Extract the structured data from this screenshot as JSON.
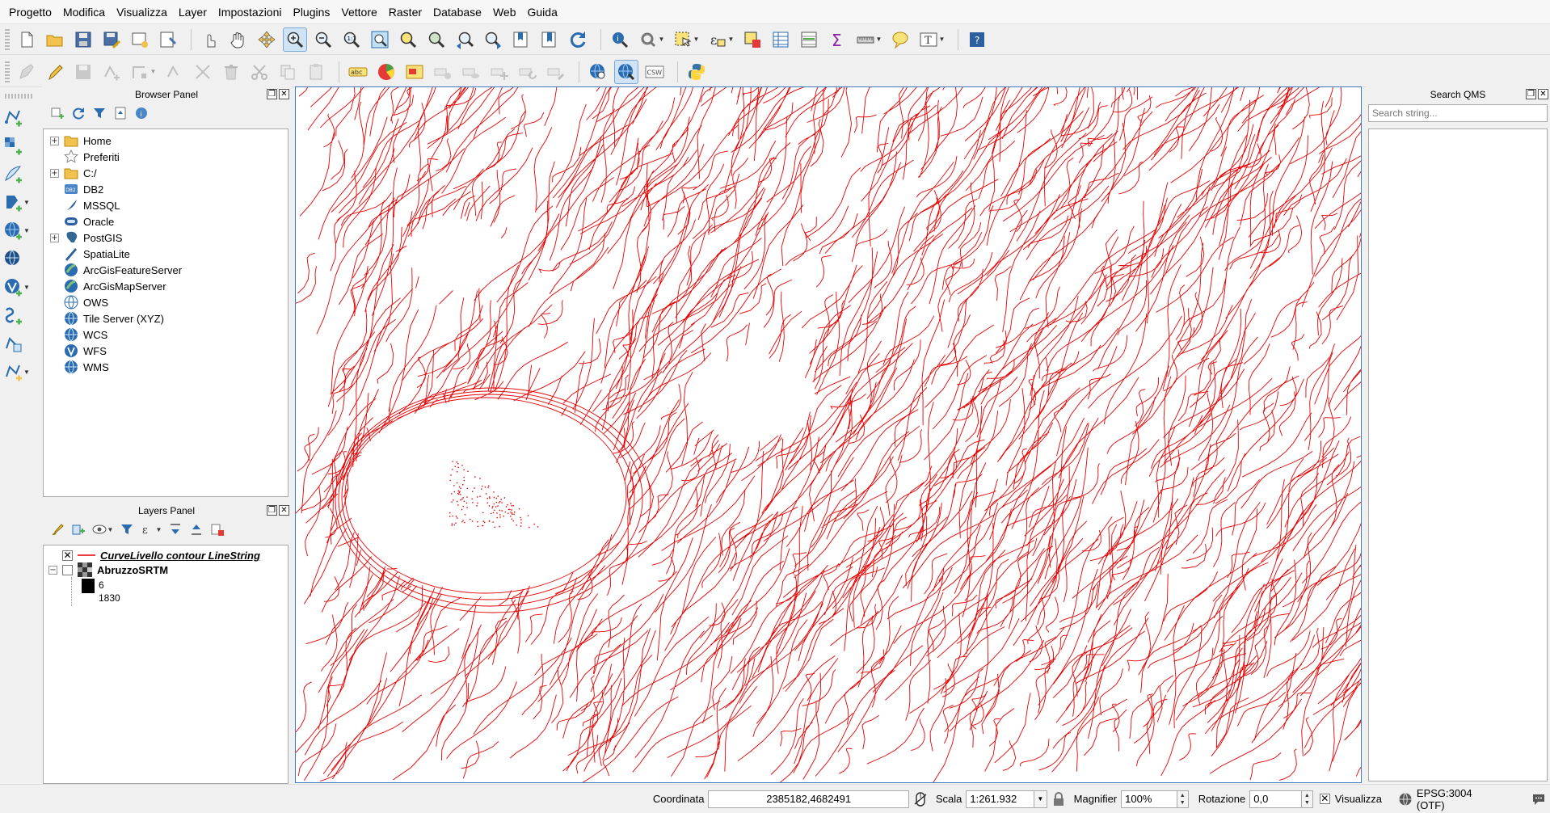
{
  "menubar": {
    "items": [
      "Progetto",
      "Modifica",
      "Visualizza",
      "Layer",
      "Impostazioni",
      "Plugins",
      "Vettore",
      "Raster",
      "Database",
      "Web",
      "Guida"
    ]
  },
  "toolbars": {
    "row1_icons": [
      "new-project-icon",
      "open-project-icon",
      "save-project-icon",
      "save-as-icon",
      "new-print-layout-icon",
      "layout-manager-icon",
      "touch-zoom-icon",
      "pan-icon",
      "pan-to-selection-icon",
      "zoom-in-icon",
      "zoom-out-icon",
      "zoom-native-icon",
      "zoom-full-icon",
      "zoom-to-selection-icon",
      "zoom-to-layer-icon",
      "zoom-last-icon",
      "zoom-next-icon",
      "new-bookmark-icon",
      "show-bookmarks-icon",
      "refresh-icon",
      "identify-icon",
      "action-icon",
      "select-feature-icon",
      "select-by-expression-icon",
      "deselect-icon",
      "attribute-table-icon",
      "field-calculator-icon",
      "statistics-icon",
      "measure-icon",
      "map-tips-icon",
      "text-annotation-icon",
      "help-icon"
    ],
    "row2_icons": [
      "current-edits-icon",
      "toggle-editing-icon",
      "save-edits-icon",
      "add-feature-icon",
      "vertex-tool-icon",
      "digitize-icon",
      "node-tool-icon",
      "delete-selected-icon",
      "cut-features-icon",
      "copy-features-icon",
      "paste-features-icon",
      "label-toolbar-icon",
      "diagram-icon",
      "pin-labels-icon",
      "show-hide-labels-icon",
      "preview-labels-icon",
      "move-label-icon",
      "rotate-label-icon",
      "change-label-icon",
      "metasearch-icon",
      "qms-icon",
      "csw-icon",
      "python-console-icon"
    ],
    "csw_text": "CSW",
    "abc_text": "abc"
  },
  "browser_panel": {
    "title": "Browser Panel",
    "items": [
      {
        "label": "Home",
        "expandable": true,
        "icon": "folder-icon"
      },
      {
        "label": "Preferiti",
        "expandable": false,
        "icon": "star-icon"
      },
      {
        "label": "C:/",
        "expandable": true,
        "icon": "folder-icon"
      },
      {
        "label": "DB2",
        "expandable": false,
        "icon": "db2-icon"
      },
      {
        "label": "MSSQL",
        "expandable": false,
        "icon": "mssql-icon"
      },
      {
        "label": "Oracle",
        "expandable": false,
        "icon": "oracle-icon"
      },
      {
        "label": "PostGIS",
        "expandable": true,
        "icon": "postgis-icon"
      },
      {
        "label": "SpatiaLite",
        "expandable": false,
        "icon": "spatialite-icon"
      },
      {
        "label": "ArcGisFeatureServer",
        "expandable": false,
        "icon": "arcgis-icon"
      },
      {
        "label": "ArcGisMapServer",
        "expandable": false,
        "icon": "arcgis-icon"
      },
      {
        "label": "OWS",
        "expandable": false,
        "icon": "ows-icon"
      },
      {
        "label": "Tile Server (XYZ)",
        "expandable": false,
        "icon": "globe-icon"
      },
      {
        "label": "WCS",
        "expandable": false,
        "icon": "globe-icon"
      },
      {
        "label": "WFS",
        "expandable": false,
        "icon": "wfs-icon"
      },
      {
        "label": "WMS",
        "expandable": false,
        "icon": "globe-icon"
      }
    ],
    "db2_text": "DB2"
  },
  "layers_panel": {
    "title": "Layers Panel",
    "layers": [
      {
        "name": "CurveLivello contour LineString",
        "checked": true,
        "selected": true
      },
      {
        "name": "AbruzzoSRTM",
        "checked": false,
        "selected": false
      }
    ],
    "legend": {
      "min": "6",
      "max": "1830"
    }
  },
  "search_qms": {
    "title": "Search QMS",
    "placeholder": "Search string..."
  },
  "map": {
    "contour_color": "#e60000",
    "background_color": "#ffffff",
    "border_color": "#3f7ac5"
  },
  "statusbar": {
    "coord_label": "Coordinata",
    "coord_value": "2385182,4682491",
    "scale_label": "Scala",
    "scale_value": "1:261.932",
    "magnifier_label": "Magnifier",
    "magnifier_value": "100%",
    "rotation_label": "Rotazione",
    "rotation_value": "0,0",
    "render_label": "Visualizza",
    "render_checked": true,
    "crs_label": "EPSG:3004 (OTF)"
  }
}
